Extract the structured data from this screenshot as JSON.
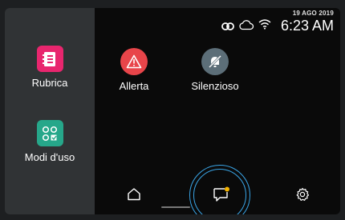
{
  "status_bar": {
    "date": "19 AGO 2019",
    "time": "6:23 AM",
    "icons": [
      "pair-icon",
      "cloud-icon",
      "wifi-icon"
    ]
  },
  "sidebar": {
    "apps": [
      {
        "label": "Rubrica",
        "icon": "address-book-icon",
        "color": "#e8266e"
      },
      {
        "label": "Modi d'uso",
        "icon": "usage-modes-icon",
        "color": "#26a78a"
      }
    ]
  },
  "main": {
    "apps": [
      {
        "label": "Allerta",
        "icon": "alert-icon",
        "color": "#e8454a"
      },
      {
        "label": "Silenzioso",
        "icon": "mute-bell-icon",
        "color": "#5c6e78"
      }
    ]
  },
  "nav": {
    "items": [
      "home-icon",
      "messages-icon",
      "settings-icon"
    ],
    "active": "messages-icon",
    "notification_color": "#f5b400",
    "highlight_color": "#3aa6e8"
  }
}
